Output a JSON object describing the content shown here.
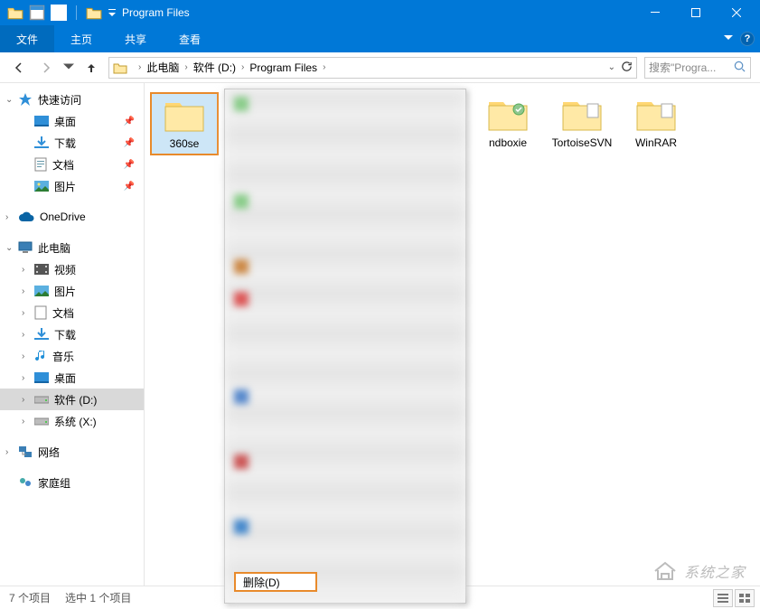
{
  "window": {
    "title": "Program Files"
  },
  "ribbon": {
    "file": "文件",
    "tabs": [
      "主页",
      "共享",
      "查看"
    ]
  },
  "breadcrumb": [
    "此电脑",
    "软件 (D:)",
    "Program Files"
  ],
  "search": {
    "placeholder": "搜索\"Progra..."
  },
  "sidebar": {
    "quick": {
      "label": "快速访问",
      "items": [
        {
          "label": "桌面",
          "icon": "desktop",
          "pinned": true
        },
        {
          "label": "下载",
          "icon": "download",
          "pinned": true
        },
        {
          "label": "文档",
          "icon": "document",
          "pinned": true
        },
        {
          "label": "图片",
          "icon": "picture",
          "pinned": true
        }
      ]
    },
    "onedrive": "OneDrive",
    "thispc": {
      "label": "此电脑",
      "items": [
        {
          "label": "视频",
          "icon": "video"
        },
        {
          "label": "图片",
          "icon": "picture"
        },
        {
          "label": "文档",
          "icon": "document"
        },
        {
          "label": "下载",
          "icon": "download"
        },
        {
          "label": "音乐",
          "icon": "music"
        },
        {
          "label": "桌面",
          "icon": "desktop"
        },
        {
          "label": "软件 (D:)",
          "icon": "drive",
          "selected": true
        },
        {
          "label": "系统 (X:)",
          "icon": "drive"
        }
      ]
    },
    "network": "网络",
    "homegroup": "家庭组"
  },
  "folders": [
    {
      "name": "360se",
      "selected": true
    },
    {
      "name": "ndboxie"
    },
    {
      "name": "TortoiseSVN"
    },
    {
      "name": "WinRAR"
    }
  ],
  "contextmenu": {
    "delete": "删除(D)"
  },
  "status": {
    "count": "7 个项目",
    "selection": "选中 1 个项目"
  },
  "watermark": "系统之家"
}
